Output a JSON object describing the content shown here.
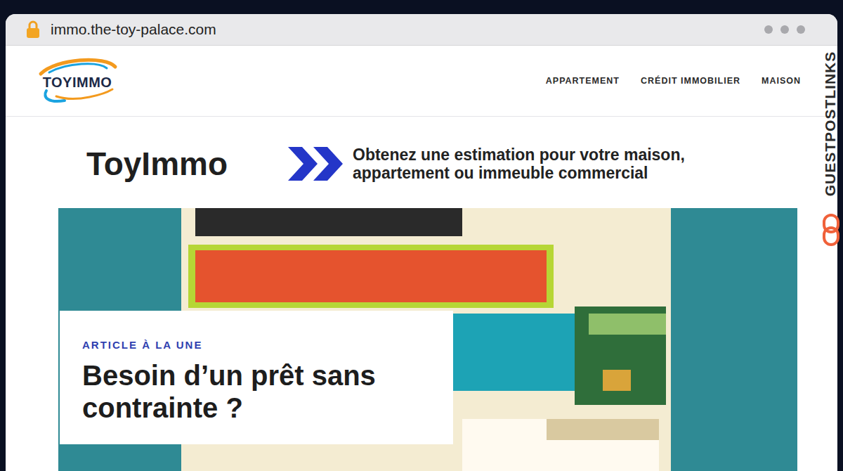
{
  "browser": {
    "url": "immo.the-toy-palace.com"
  },
  "site": {
    "logo": "TOYIMMO",
    "nav": [
      {
        "label": "APPARTEMENT"
      },
      {
        "label": "CRÉDIT IMMOBILIER"
      },
      {
        "label": "MAISON"
      }
    ],
    "brand": "ToyImmo",
    "tagline": "Obtenez une estimation pour votre maison, appartement ou immeuble commercial"
  },
  "featured": {
    "kicker": "ARTICLE À LA UNE",
    "title": "Besoin d’un prêt sans contrainte ?"
  },
  "watermark": "GUESTPOSTLINKS"
}
